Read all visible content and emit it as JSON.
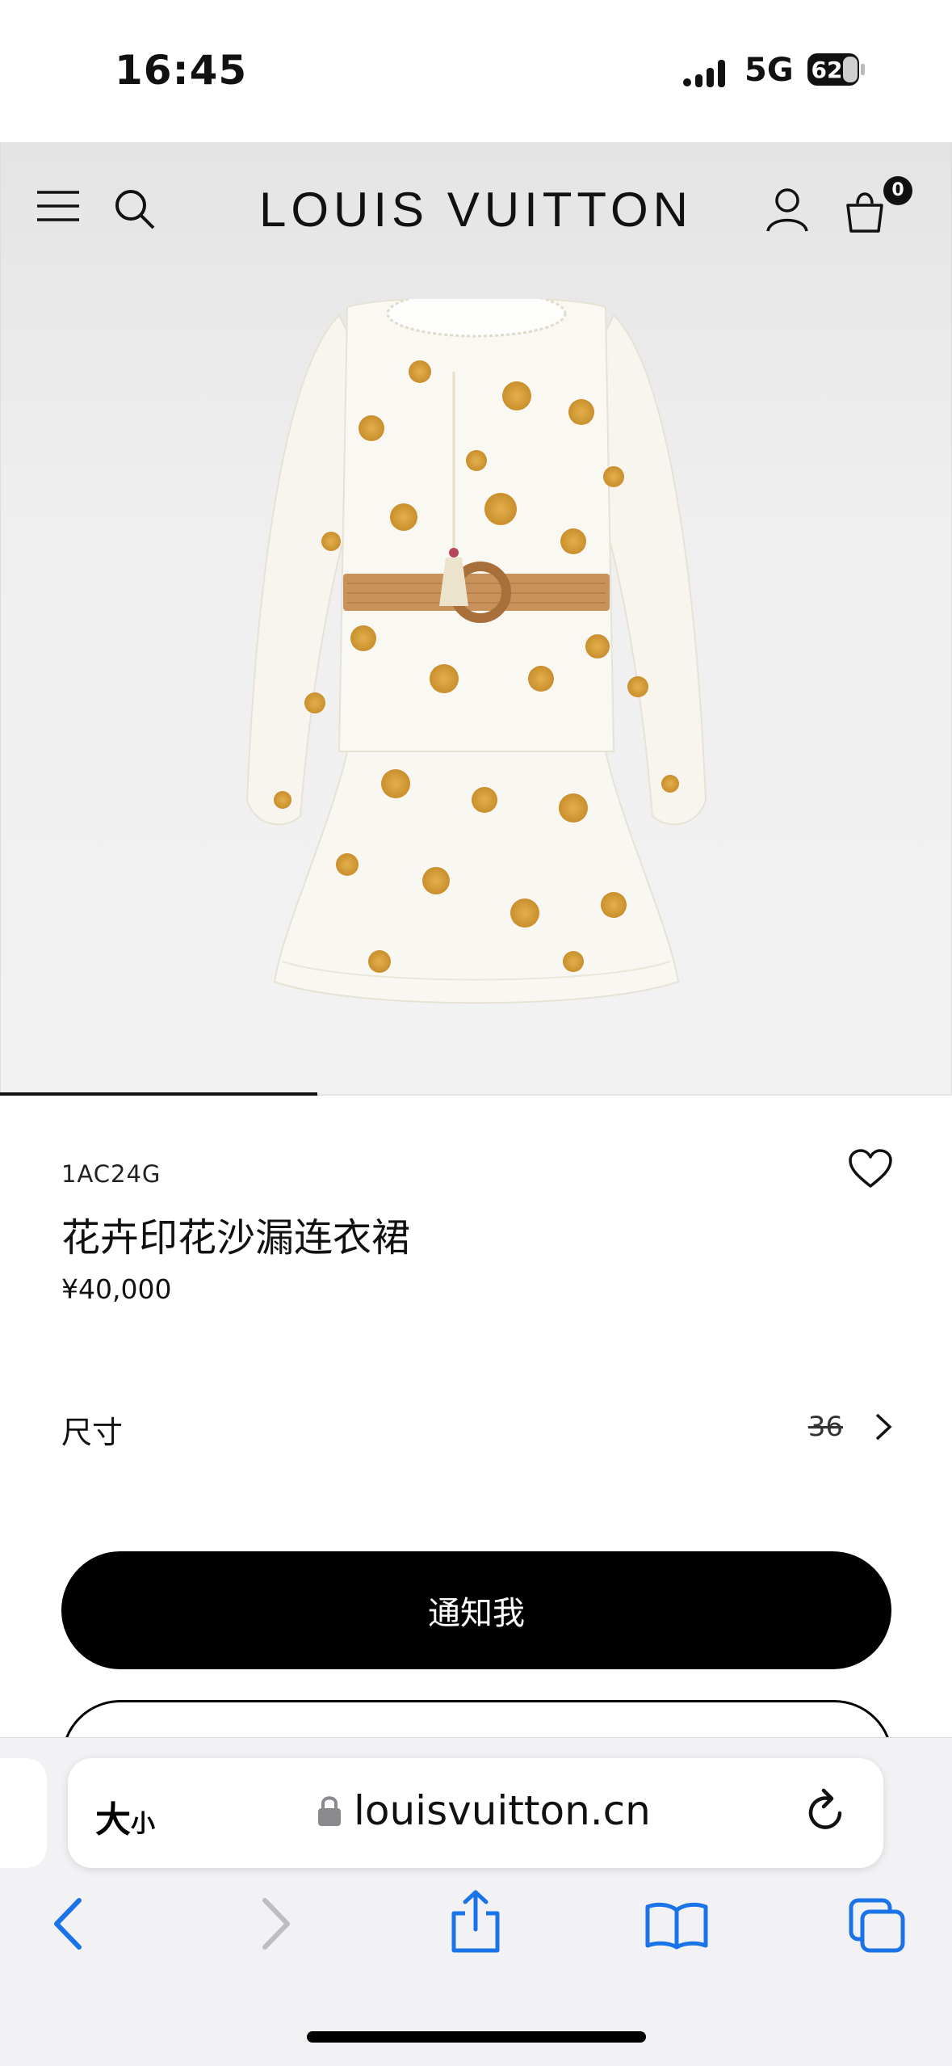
{
  "status_bar": {
    "time": "16:45",
    "network": "5G",
    "battery": "62"
  },
  "header": {
    "brand": "LOUIS VUITTON",
    "cart_count": "0"
  },
  "gallery": {
    "progress": 0.333
  },
  "product": {
    "sku": "1AC24G",
    "title": "花卉印花沙漏连衣裙",
    "price": "¥40,000",
    "size_label": "尺寸",
    "size_value": "36",
    "notify_button": "通知我"
  },
  "browser": {
    "text_size_big": "大",
    "text_size_small": "小",
    "url": "louisvuitton.cn"
  },
  "icons": {
    "menu": "menu-icon",
    "search": "search-icon",
    "account": "account-icon",
    "cart": "shopping-bag-icon",
    "wishlist": "heart-icon",
    "lock": "lock-icon",
    "reload": "reload-icon",
    "back": "back-arrow-icon",
    "forward": "forward-arrow-icon",
    "share": "share-icon",
    "bookmarks": "bookmarks-icon",
    "tabs": "tabs-icon"
  },
  "colors": {
    "accent_blue": "#1a73e8",
    "black": "#000000",
    "belt": "#c8925a",
    "print": "#d9a23e"
  }
}
